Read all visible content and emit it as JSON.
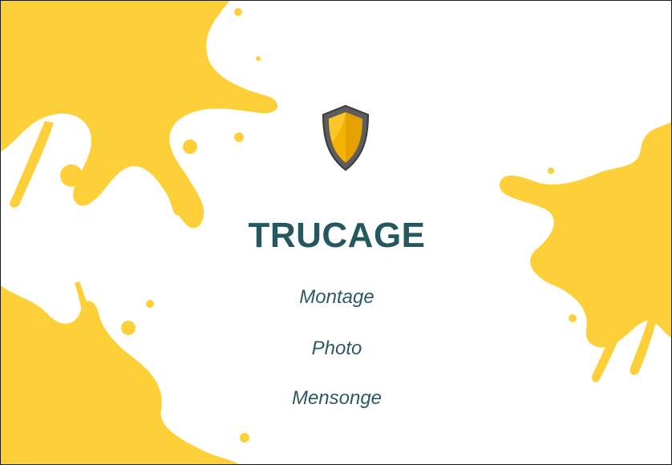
{
  "slide": {
    "title": "TRUCAGE",
    "keywords": [
      "Montage",
      "Photo",
      "Mensonge"
    ]
  },
  "icon": "shield-icon",
  "colors": {
    "splash": "#fdd03a",
    "title": "#25575f",
    "shield_fill": "#f5b400",
    "shield_rim": "#5d5d5d"
  }
}
